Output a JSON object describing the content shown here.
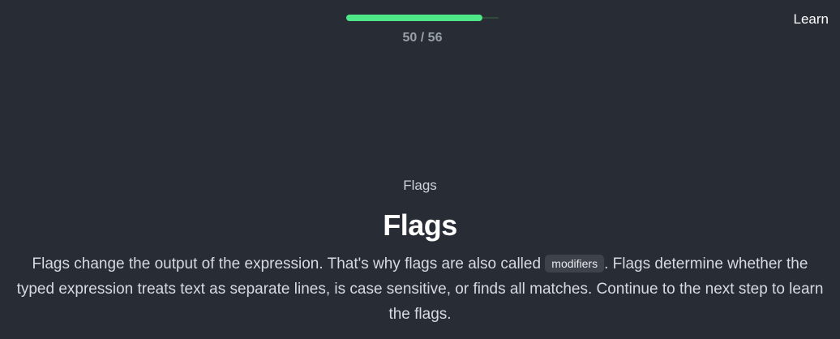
{
  "progress": {
    "current": 50,
    "total": 56,
    "label": "50 / 56",
    "fill_fraction": 0.893
  },
  "nav": {
    "learn_label": "Learn"
  },
  "lesson": {
    "kicker": "Flags",
    "title": "Flags",
    "description_before": "Flags change the output of the expression. That's why flags are also called ",
    "code_term": "modifiers",
    "description_after": ". Flags determine whether the typed expression treats text as separate lines, is case sensitive, or finds all matches. Continue to the next step to learn the flags."
  },
  "colors": {
    "background": "#282c34",
    "progress_accent": "#4ee888"
  }
}
